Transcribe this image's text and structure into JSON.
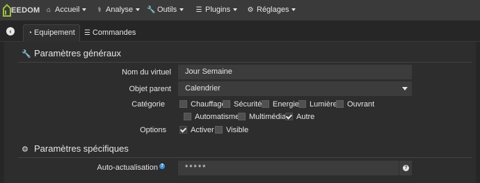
{
  "navbar": {
    "logo_text": "EEDOM",
    "menus": [
      {
        "label": "Accueil",
        "icon": "home-icon"
      },
      {
        "label": "Analyse",
        "icon": "stethoscope-icon"
      },
      {
        "label": "Outils",
        "icon": "wrench-icon"
      },
      {
        "label": "Plugins",
        "icon": "tasks-icon"
      },
      {
        "label": "Réglages",
        "icon": "cogs-icon"
      }
    ]
  },
  "tabs": {
    "back_icon": "arrow-circle-left-icon",
    "items": [
      {
        "label": "Equipement",
        "icon": "tachometer-icon",
        "active": true
      },
      {
        "label": "Commandes",
        "icon": "list-icon",
        "active": false
      }
    ]
  },
  "general": {
    "title": "Paramètres généraux",
    "icon": "wrench-icon",
    "name_label": "Nom du virtuel",
    "name_value": "Jour Semaine",
    "parent_label": "Objet parent",
    "parent_value": "Calendrier",
    "category_label": "Catégorie",
    "categories": [
      {
        "label": "Chauffage",
        "checked": false
      },
      {
        "label": "Sécurité",
        "checked": false
      },
      {
        "label": "Energie",
        "checked": false
      },
      {
        "label": "Lumière",
        "checked": false
      },
      {
        "label": "Ouvrant",
        "checked": false
      },
      {
        "label": "Automatisme",
        "checked": false
      },
      {
        "label": "Multimédia",
        "checked": false
      },
      {
        "label": "Autre",
        "checked": true
      }
    ],
    "options_label": "Options",
    "options": [
      {
        "label": "Activer",
        "checked": true
      },
      {
        "label": "Visible",
        "checked": false
      }
    ]
  },
  "specific": {
    "title": "Paramètres spécifiques",
    "icon": "cogs-icon",
    "autorefresh_label": "Auto-actualisation",
    "autorefresh_value": "*****",
    "help_glyph": "?"
  }
}
